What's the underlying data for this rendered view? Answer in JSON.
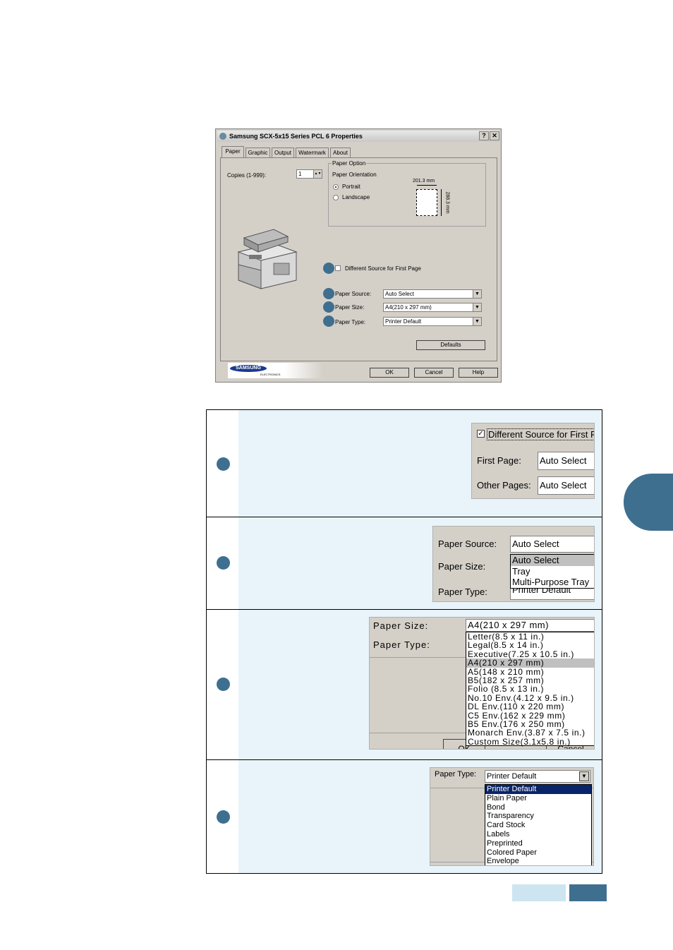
{
  "dialog": {
    "title": "Samsung SCX-5x15 Series PCL 6 Properties",
    "help_glyph": "?",
    "close_glyph": "✕",
    "tabs": [
      "Paper",
      "Graphic",
      "Output",
      "Watermark",
      "About"
    ],
    "copies_label": "Copies (1-999):",
    "copies_value": "1",
    "paper_option_label": "Paper Option",
    "orientation_label": "Paper Orientation",
    "portrait": "Portrait",
    "landscape": "Landscape",
    "width_dim": "201.3 mm",
    "height_dim": "288.3 mm",
    "diff_source_label": "Different Source for First Page",
    "paper_source_label": "Paper Source:",
    "paper_source_value": "Auto Select",
    "paper_size_label": "Paper Size:",
    "paper_size_value": "A4(210 x 297 mm)",
    "paper_type_label": "Paper Type:",
    "paper_type_value": "Printer Default",
    "defaults_button": "Defaults",
    "logo_brand": "SAMSUNG",
    "logo_sub": "ELECTRONICS",
    "ok_button": "OK",
    "cancel_button": "Cancel",
    "help_button": "Help"
  },
  "rows": {
    "first_page": {
      "checkbox_label": "Different Source for First Page",
      "first_page_label": "First Page:",
      "first_page_value": "Auto Select",
      "other_pages_label": "Other Pages:",
      "other_pages_value": "Auto Select"
    },
    "source": {
      "source_label": "Paper Source:",
      "source_value": "Auto Select",
      "size_label": "Paper Size:",
      "type_label": "Paper Type:",
      "type_value": "Printer Default",
      "options": [
        "Auto Select",
        "Tray",
        "Multi-Purpose Tray"
      ]
    },
    "size": {
      "size_label": "Paper Size:",
      "size_value": "A4(210 x 297 mm)",
      "type_label": "Paper Type:",
      "ok_partial": "OK",
      "cancel_partial": "Cancel",
      "options": [
        "Letter(8.5 x 11 in.)",
        "Legal(8.5 x 14 in.)",
        "Executive(7.25 x 10.5 in.)",
        "A4(210 x 297 mm)",
        "A5(148 x 210 mm)",
        "B5(182 x 257 mm)",
        "Folio (8.5 x 13 in.)",
        "No.10 Env.(4.12 x 9.5 in.)",
        "DL Env.(110 x 220 mm)",
        "C5 Env.(162 x 229 mm)",
        "B5 Env.(176 x 250 mm)",
        "Monarch Env.(3.87 x 7.5 in.)",
        "Custom Size(3.1x5.8 in.)"
      ]
    },
    "type": {
      "type_label": "Paper Type:",
      "type_value": "Printer Default",
      "options": [
        "Printer Default",
        "Plain Paper",
        "Bond",
        "Transparency",
        "Card Stock",
        "Labels",
        "Preprinted",
        "Colored Paper",
        "Envelope"
      ]
    }
  },
  "colors": {
    "accent": "#3f6f8f",
    "light_bar": "#cde5f0",
    "row_bg": "#e8f4fa"
  }
}
